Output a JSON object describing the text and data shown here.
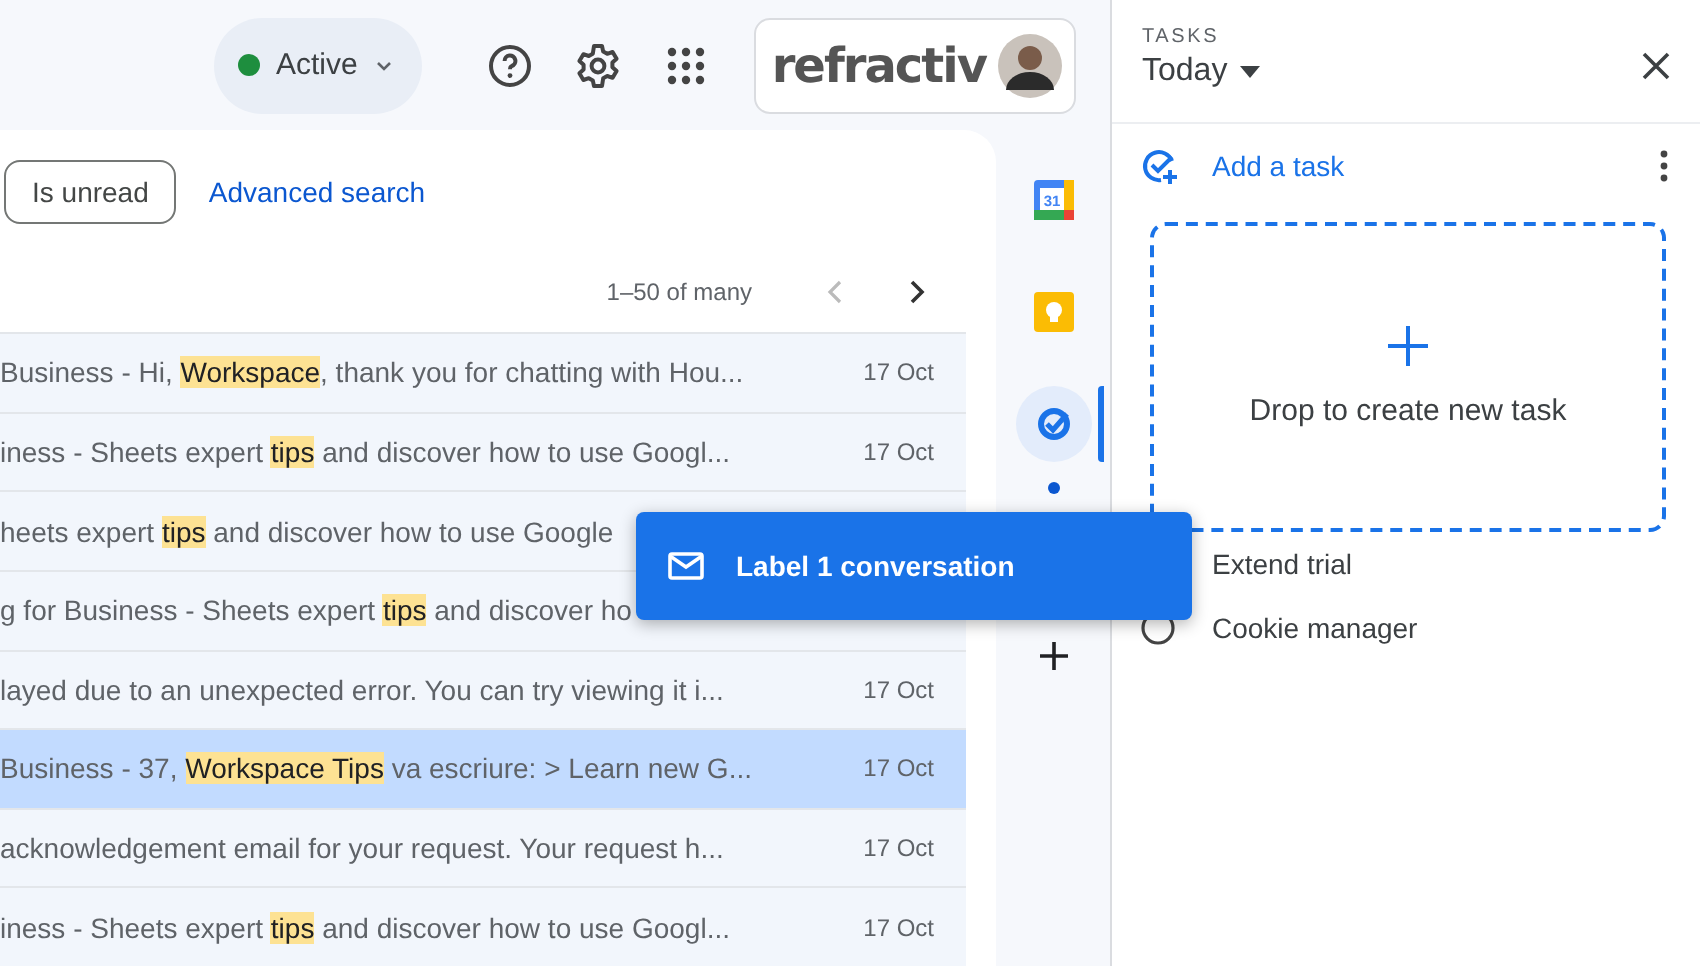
{
  "top_bar": {
    "status": "Active",
    "logo": "refractiv"
  },
  "filters": {
    "chips": [
      "Is unread"
    ],
    "link": "Advanced search"
  },
  "pagination": {
    "range": "1–50 of many"
  },
  "messages": [
    {
      "parts": [
        {
          "text": "Business - Hi, ",
          "highlight": false
        },
        {
          "text": "Workspace",
          "highlight": true
        },
        {
          "text": ", thank you for chatting with Hou...",
          "highlight": false
        }
      ],
      "date": "17 Oct",
      "selected": false
    },
    {
      "parts": [
        {
          "text": "iness - Sheets expert ",
          "highlight": false
        },
        {
          "text": "tips",
          "highlight": true
        },
        {
          "text": " and discover how to use Googl...",
          "highlight": false
        }
      ],
      "date": "17 Oct",
      "selected": false
    },
    {
      "parts": [
        {
          "text": "heets expert ",
          "highlight": false
        },
        {
          "text": "tips",
          "highlight": true
        },
        {
          "text": " and discover how to use Google",
          "highlight": false
        }
      ],
      "selected": false
    },
    {
      "parts": [
        {
          "text": "g for Business - Sheets expert ",
          "highlight": false
        },
        {
          "text": "tips",
          "highlight": true
        },
        {
          "text": " and discover ho",
          "highlight": false
        }
      ],
      "selected": false
    },
    {
      "parts": [
        {
          "text": "layed due to an unexpected error. You can try viewing it i...",
          "highlight": false
        }
      ],
      "date": "17 Oct",
      "selected": false
    },
    {
      "parts": [
        {
          "text": "Business - 37, ",
          "highlight": false
        },
        {
          "text": "Workspace ",
          "highlight": true
        },
        {
          "text": "Tips",
          "highlight": true
        },
        {
          "text": " va escriure: > Learn new G...",
          "highlight": false
        }
      ],
      "date": "17 Oct",
      "selected": true
    },
    {
      "parts": [
        {
          "text": "acknowledgement email for your request. Your request h...",
          "highlight": false
        }
      ],
      "date": "17 Oct",
      "selected": false
    },
    {
      "parts": [
        {
          "text": "iness - Sheets expert ",
          "highlight": false
        },
        {
          "text": "tips",
          "highlight": true
        },
        {
          "text": " and discover how to use Googl...",
          "highlight": false
        }
      ],
      "date": "17 Oct",
      "selected": false
    }
  ],
  "side_rail": {
    "apps": [
      {
        "kind": "calendar",
        "label": "31",
        "selected": false
      },
      {
        "kind": "keep",
        "selected": false
      },
      {
        "kind": "tasks",
        "selected": true
      },
      {
        "kind": "dot",
        "selected": false
      },
      {
        "kind": "add",
        "selected": false
      }
    ]
  },
  "tasks_panel": {
    "heading": "TASKS",
    "list": "Today",
    "add_label": "Add a task",
    "drop_zone": "Drop to create new task",
    "tasks": [
      {
        "title": "Extend trial"
      },
      {
        "title": "Cookie manager",
        "done": false
      }
    ]
  },
  "drag_tooltip": {
    "label": "Label 1 conversation"
  }
}
